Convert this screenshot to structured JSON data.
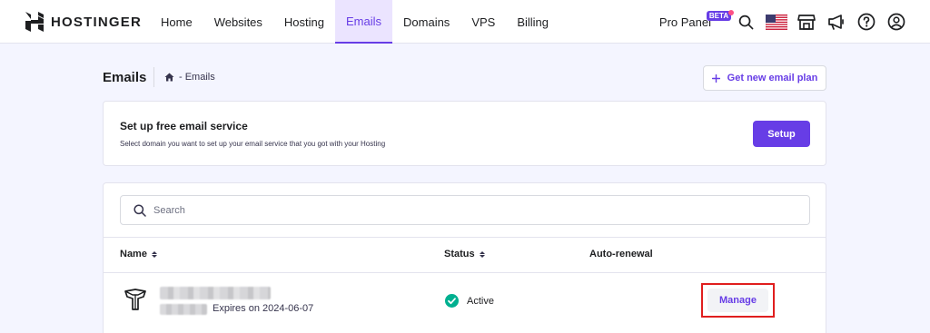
{
  "header": {
    "brand": "HOSTINGER",
    "nav": [
      {
        "label": "Home",
        "active": false
      },
      {
        "label": "Websites",
        "active": false
      },
      {
        "label": "Hosting",
        "active": false
      },
      {
        "label": "Emails",
        "active": true
      },
      {
        "label": "Domains",
        "active": false
      },
      {
        "label": "VPS",
        "active": false
      },
      {
        "label": "Billing",
        "active": false
      }
    ],
    "pro_panel": "Pro Panel",
    "beta_badge": "BETA",
    "tools": [
      "search-icon",
      "us-flag-icon",
      "store-icon",
      "megaphone-icon",
      "help-icon",
      "account-icon"
    ]
  },
  "page": {
    "title": "Emails",
    "breadcrumb": {
      "home_icon": "home-icon",
      "text": "- Emails"
    },
    "get_plan_button": "Get new email plan"
  },
  "setup_card": {
    "title": "Set up free email service",
    "description": "Select domain you want to set up your email service that you got with your Hosting",
    "button": "Setup"
  },
  "list": {
    "search_placeholder": "Search",
    "columns": {
      "name": "Name",
      "status": "Status",
      "auto_renewal": "Auto-renewal"
    },
    "rows": [
      {
        "domain": "",
        "expires": "Expires on 2024-06-07",
        "status": "Active",
        "action": "Manage"
      }
    ]
  },
  "colors": {
    "accent": "#673de6",
    "success": "#00b090",
    "highlight": "#e01e1e"
  }
}
